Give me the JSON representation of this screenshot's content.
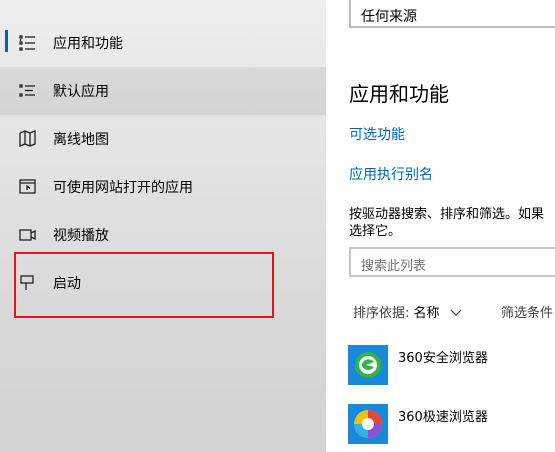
{
  "sidebar": {
    "items": [
      {
        "label": "应用和功能",
        "icon": "apps-features-icon",
        "selected": true
      },
      {
        "label": "默认应用",
        "icon": "default-apps-icon",
        "hover": true
      },
      {
        "label": "离线地图",
        "icon": "offline-maps-icon"
      },
      {
        "label": "可使用网站打开的应用",
        "icon": "apps-for-websites-icon"
      },
      {
        "label": "视频播放",
        "icon": "video-playback-icon"
      },
      {
        "label": "启动",
        "icon": "startup-icon",
        "annotated": true
      }
    ],
    "accent_color": "#0063b1",
    "annotation_color": "#e5161b"
  },
  "main": {
    "source_select_value": "任何来源",
    "section_title": "应用和功能",
    "links": {
      "optional_features": "可选功能",
      "app_execution_aliases": "应用执行别名"
    },
    "description_line1": "按驱动器搜索、排序和筛选。如果",
    "description_line2": "选择它。",
    "search_placeholder": "搜索此列表",
    "sort_label": "排序依据:",
    "sort_value": "名称",
    "filter_label": "筛选条件",
    "apps": [
      {
        "name": "360安全浏览器",
        "icon": "360-safe-browser-icon"
      },
      {
        "name": "360极速浏览器",
        "icon": "360-speed-browser-icon"
      }
    ],
    "link_color": "#0067b8"
  }
}
